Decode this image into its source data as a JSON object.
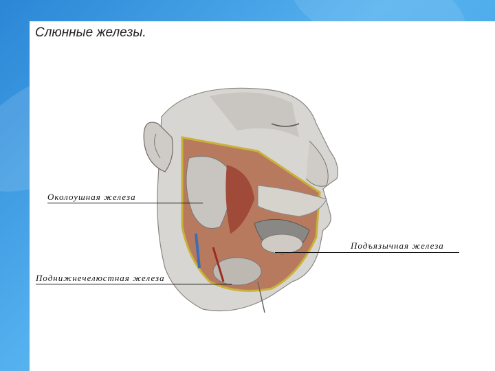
{
  "slide": {
    "title": "Слюнные железы.",
    "labels": {
      "parotid": "Околоушная железа",
      "sublingual": "Подъязычная железа",
      "submandibular": "Поднижнечелюстная железа"
    }
  },
  "colors": {
    "background_blue": "#3f9ee6",
    "slide_white": "#ffffff",
    "gland_gray": "#c8c4c0",
    "muscle_red": "#a04a3a",
    "skin_gray": "#d8d6d2"
  }
}
